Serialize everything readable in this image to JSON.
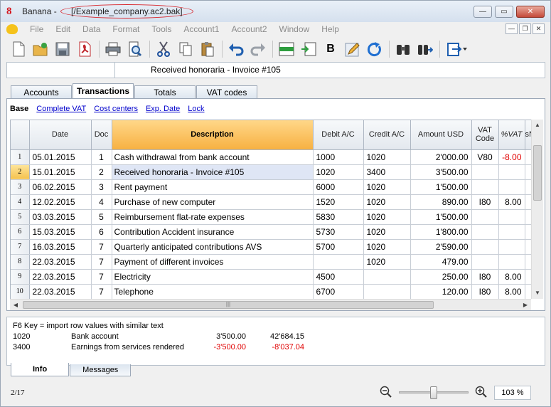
{
  "titlebar": {
    "app_name": "Banana",
    "separator": " - ",
    "file": "[/Example_company.ac2.bak]",
    "buttons": {
      "minimize": "—",
      "restore": "▭",
      "close": "✕"
    }
  },
  "menu": {
    "items": [
      "File",
      "Edit",
      "Data",
      "Format",
      "Tools",
      "Account1",
      "Account2",
      "Window",
      "Help"
    ],
    "mdi": {
      "minimize": "—",
      "restore": "❐",
      "close": "✕"
    }
  },
  "toolbar": {
    "bold_label": "B"
  },
  "editline": {
    "ref": "",
    "value": "Received honoraria - Invoice #105"
  },
  "tabs": [
    "Accounts",
    "Transactions",
    "Totals",
    "VAT codes"
  ],
  "views": [
    "Base",
    "Complete VAT",
    "Cost centers",
    "Exp. Date",
    "Lock"
  ],
  "columns": {
    "date": "Date",
    "doc": "Doc",
    "description": "Description",
    "debit": "Debit A/C",
    "credit": "Credit A/C",
    "amount": "Amount USD",
    "vat_code_l1": "VAT",
    "vat_code_l2": "Code",
    "vat_pct": "%VAT",
    "next": "sN"
  },
  "rows": [
    {
      "n": "1",
      "date": "05.01.2015",
      "doc": "1",
      "desc": "Cash withdrawal from bank account",
      "debit": "1000",
      "credit": "1020",
      "amount": "2'000.00",
      "vat": "V80",
      "pct": "-8.00",
      "pct_neg": true
    },
    {
      "n": "2",
      "date": "15.01.2015",
      "doc": "2",
      "desc": "Received honoraria - Invoice #105",
      "debit": "1020",
      "credit": "3400",
      "amount": "3'500.00",
      "vat": "",
      "pct": ""
    },
    {
      "n": "3",
      "date": "06.02.2015",
      "doc": "3",
      "desc": "Rent payment",
      "debit": "6000",
      "credit": "1020",
      "amount": "1'500.00",
      "vat": "",
      "pct": ""
    },
    {
      "n": "4",
      "date": "12.02.2015",
      "doc": "4",
      "desc": "Purchase of new computer",
      "debit": "1520",
      "credit": "1020",
      "amount": "890.00",
      "vat": "I80",
      "pct": "8.00"
    },
    {
      "n": "5",
      "date": "03.03.2015",
      "doc": "5",
      "desc": "Reimbursement flat-rate expenses",
      "debit": "5830",
      "credit": "1020",
      "amount": "1'500.00",
      "vat": "",
      "pct": ""
    },
    {
      "n": "6",
      "date": "15.03.2015",
      "doc": "6",
      "desc": "Contribution Accident insurance",
      "debit": "5730",
      "credit": "1020",
      "amount": "1'800.00",
      "vat": "",
      "pct": ""
    },
    {
      "n": "7",
      "date": "16.03.2015",
      "doc": "7",
      "desc": "Quarterly anticipated contributions AVS",
      "debit": "5700",
      "credit": "1020",
      "amount": "2'590.00",
      "vat": "",
      "pct": ""
    },
    {
      "n": "8",
      "date": "22.03.2015",
      "doc": "7",
      "desc": "Payment of different invoices",
      "debit": "",
      "credit": "1020",
      "amount": "479.00",
      "vat": "",
      "pct": ""
    },
    {
      "n": "9",
      "date": "22.03.2015",
      "doc": "7",
      "desc": "Electricity",
      "debit": "4500",
      "credit": "",
      "amount": "250.00",
      "vat": "I80",
      "pct": "8.00"
    },
    {
      "n": "10",
      "date": "22.03.2015",
      "doc": "7",
      "desc": "Telephone",
      "debit": "6700",
      "credit": "",
      "amount": "120.00",
      "vat": "I80",
      "pct": "8.00"
    }
  ],
  "scroll": {
    "up": "▲",
    "down": "▼",
    "left": "◀",
    "right": "▶",
    "grip": "|||"
  },
  "info": {
    "hint": "F6 Key = import row values with similar text",
    "accounts": [
      {
        "no": "1020",
        "name": "Bank account",
        "amount": "3'500.00",
        "balance": "42'684.15",
        "negative": false
      },
      {
        "no": "3400",
        "name": "Earnings from services rendered",
        "amount": "-3'500.00",
        "balance": "-8'037.04",
        "negative": true
      }
    ]
  },
  "bottom_tabs": [
    "Info",
    "Messages"
  ],
  "status": {
    "position": "2/17",
    "zoom": "103 %"
  }
}
